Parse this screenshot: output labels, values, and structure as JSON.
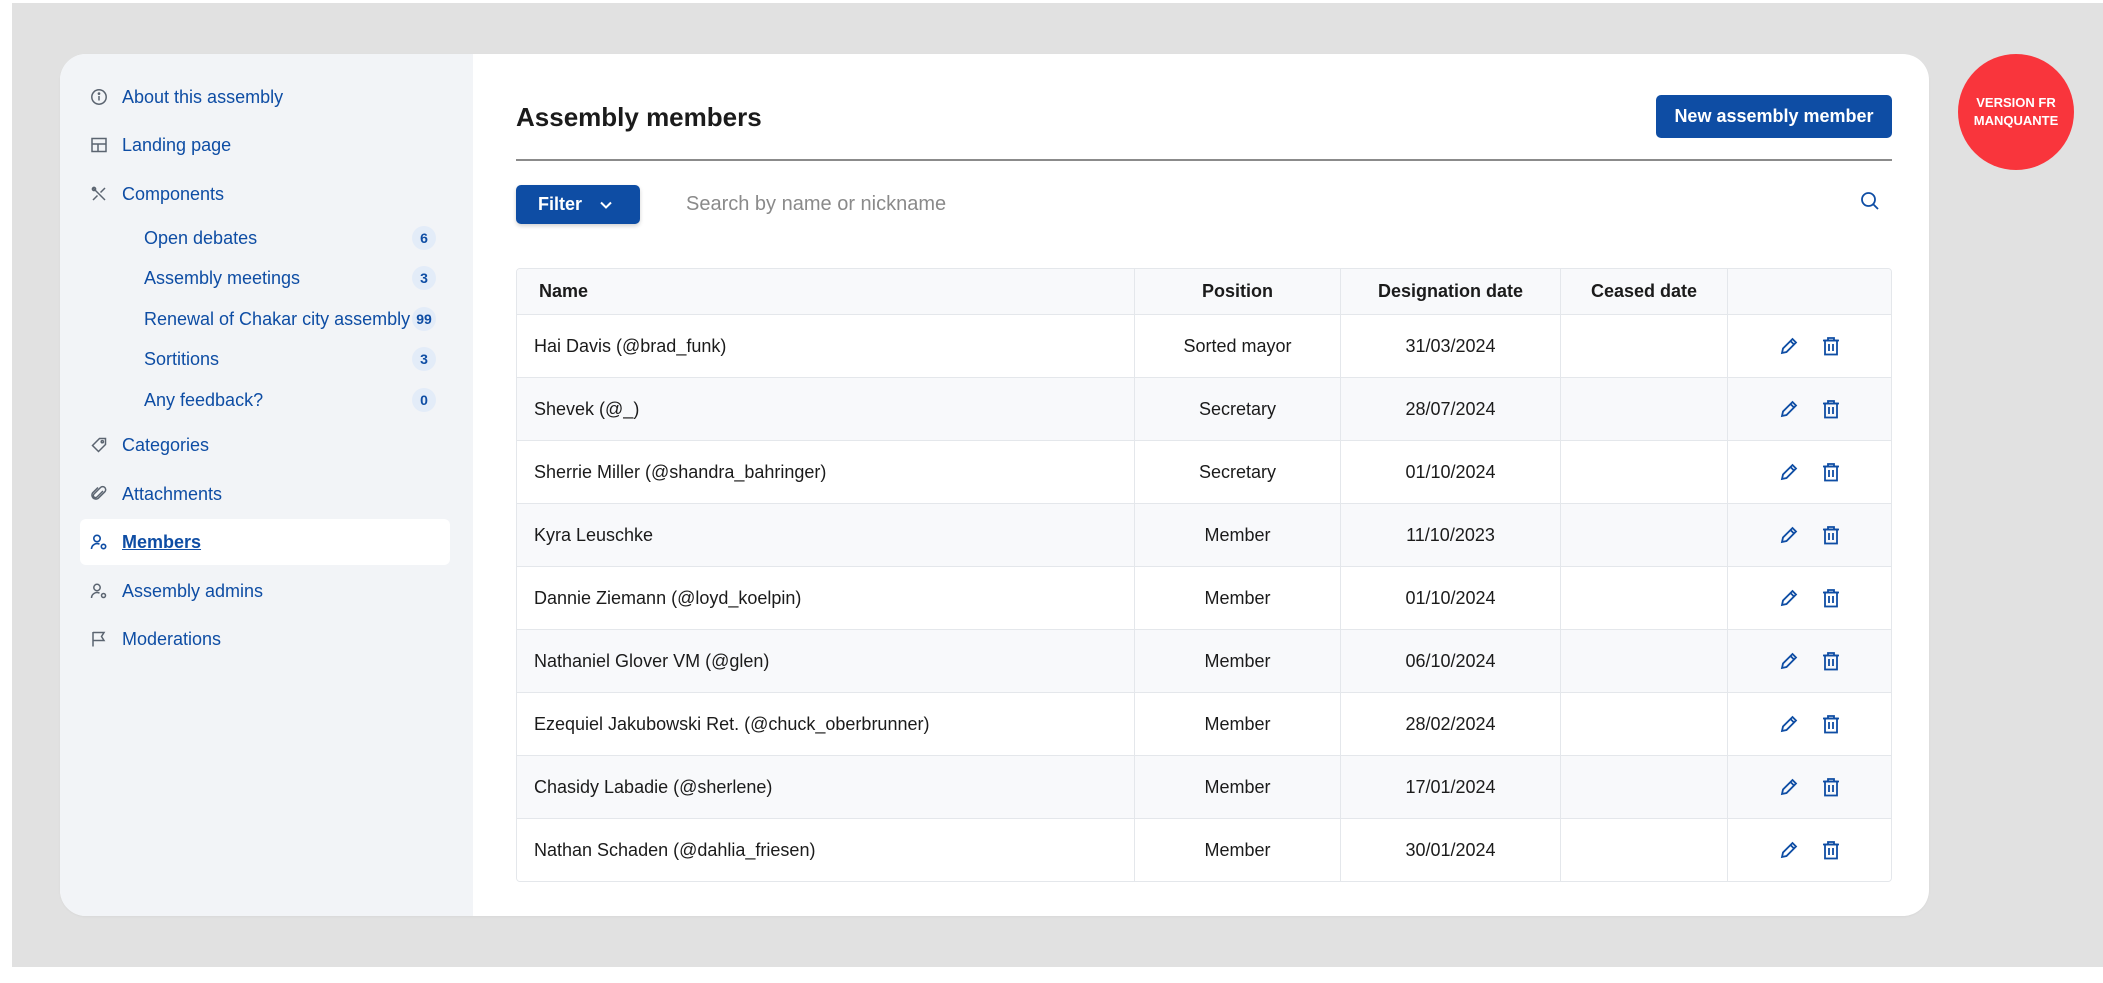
{
  "sidebar": {
    "items": [
      {
        "label": "About this assembly",
        "icon": "info-icon"
      },
      {
        "label": "Landing page",
        "icon": "layout-icon"
      },
      {
        "label": "Components",
        "icon": "tools-icon"
      },
      {
        "label": "Categories",
        "icon": "tag-icon"
      },
      {
        "label": "Attachments",
        "icon": "paperclip-icon"
      },
      {
        "label": "Members",
        "icon": "user-settings-icon",
        "active": true
      },
      {
        "label": "Assembly admins",
        "icon": "user-admin-icon"
      },
      {
        "label": "Moderations",
        "icon": "flag-icon"
      }
    ],
    "components": [
      {
        "label": "Open debates",
        "count": "6"
      },
      {
        "label": "Assembly meetings",
        "count": "3"
      },
      {
        "label": "Renewal of Chakar city assembly",
        "count": "99"
      },
      {
        "label": "Sortitions",
        "count": "3"
      },
      {
        "label": "Any feedback?",
        "count": "0"
      }
    ]
  },
  "header": {
    "title": "Assembly members",
    "new_button_label": "New assembly member"
  },
  "toolbar": {
    "filter_label": "Filter",
    "search_placeholder": "Search by name or nickname"
  },
  "table": {
    "columns": [
      "Name",
      "Position",
      "Designation date",
      "Ceased date"
    ],
    "rows": [
      {
        "name": "Hai Davis (@brad_funk)",
        "position": "Sorted mayor",
        "designation_date": "31/03/2024",
        "ceased_date": ""
      },
      {
        "name": "Shevek (@_)",
        "position": "Secretary",
        "designation_date": "28/07/2024",
        "ceased_date": ""
      },
      {
        "name": "Sherrie Miller (@shandra_bahringer)",
        "position": "Secretary",
        "designation_date": "01/10/2024",
        "ceased_date": ""
      },
      {
        "name": "Kyra Leuschke",
        "position": "Member",
        "designation_date": "11/10/2023",
        "ceased_date": ""
      },
      {
        "name": "Dannie Ziemann (@loyd_koelpin)",
        "position": "Member",
        "designation_date": "01/10/2024",
        "ceased_date": ""
      },
      {
        "name": "Nathaniel Glover VM (@glen)",
        "position": "Member",
        "designation_date": "06/10/2024",
        "ceased_date": ""
      },
      {
        "name": "Ezequiel Jakubowski Ret. (@chuck_oberbrunner)",
        "position": "Member",
        "designation_date": "28/02/2024",
        "ceased_date": ""
      },
      {
        "name": "Chasidy Labadie (@sherlene)",
        "position": "Member",
        "designation_date": "17/01/2024",
        "ceased_date": ""
      },
      {
        "name": "Nathan Schaden (@dahlia_friesen)",
        "position": "Member",
        "designation_date": "30/01/2024",
        "ceased_date": ""
      }
    ]
  },
  "version_badge": "VERSION FR MANQUANTE",
  "colors": {
    "accent": "#0e4da4",
    "sidebar_bg": "#f2f4f7",
    "badge_red": "#f9353c",
    "backdrop": "#e1e1e1"
  }
}
